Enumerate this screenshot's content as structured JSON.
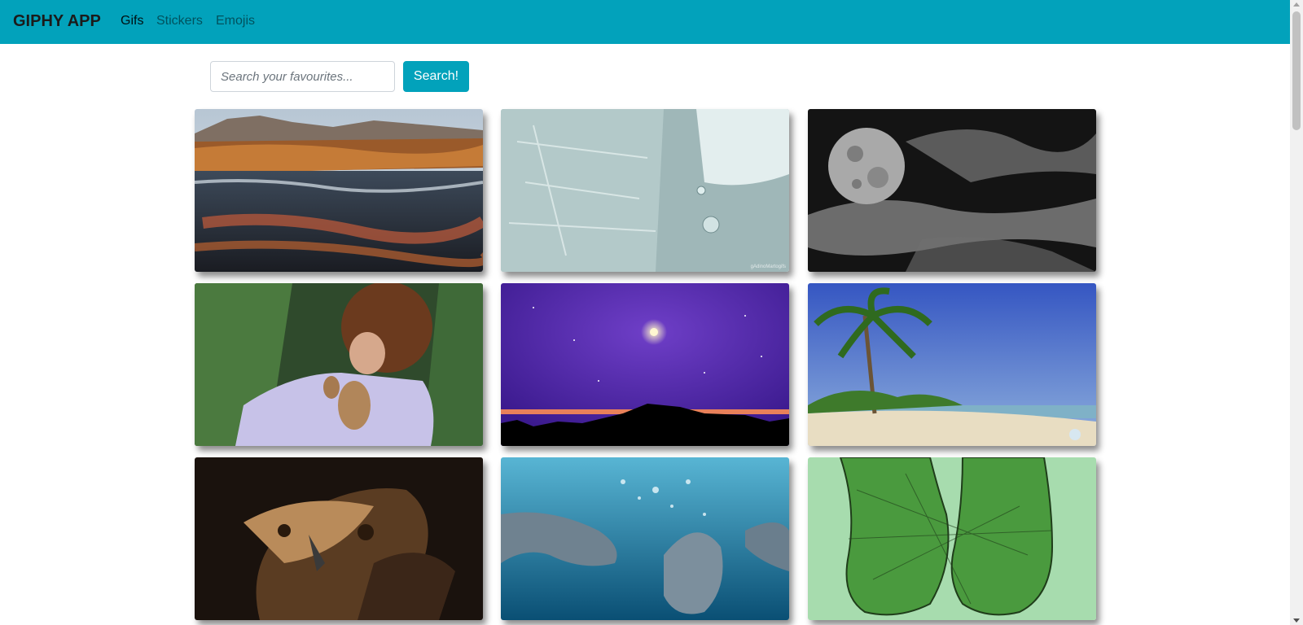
{
  "navbar": {
    "brand": "GIPHY APP",
    "links": [
      {
        "label": "Gifs",
        "active": true
      },
      {
        "label": "Stickers",
        "active": false
      },
      {
        "label": "Emojis",
        "active": false
      }
    ],
    "background_color": "#02a2bb"
  },
  "search": {
    "placeholder": "Search your favourites...",
    "value": "",
    "button_label": "Search!"
  },
  "gifs": [
    {
      "subject": "rocky river rapids landscape"
    },
    {
      "subject": "melting ice dripping water",
      "watermark": "gAdinoMartogifs"
    },
    {
      "subject": "full moon with clouds"
    },
    {
      "subject": "man holding baby deer"
    },
    {
      "subject": "purple starry night sky"
    },
    {
      "subject": "tropical beach with palm trees"
    },
    {
      "subject": "eagle in nest close-up"
    },
    {
      "subject": "dolphins swimming underwater"
    },
    {
      "subject": "green wireframe feet"
    }
  ]
}
